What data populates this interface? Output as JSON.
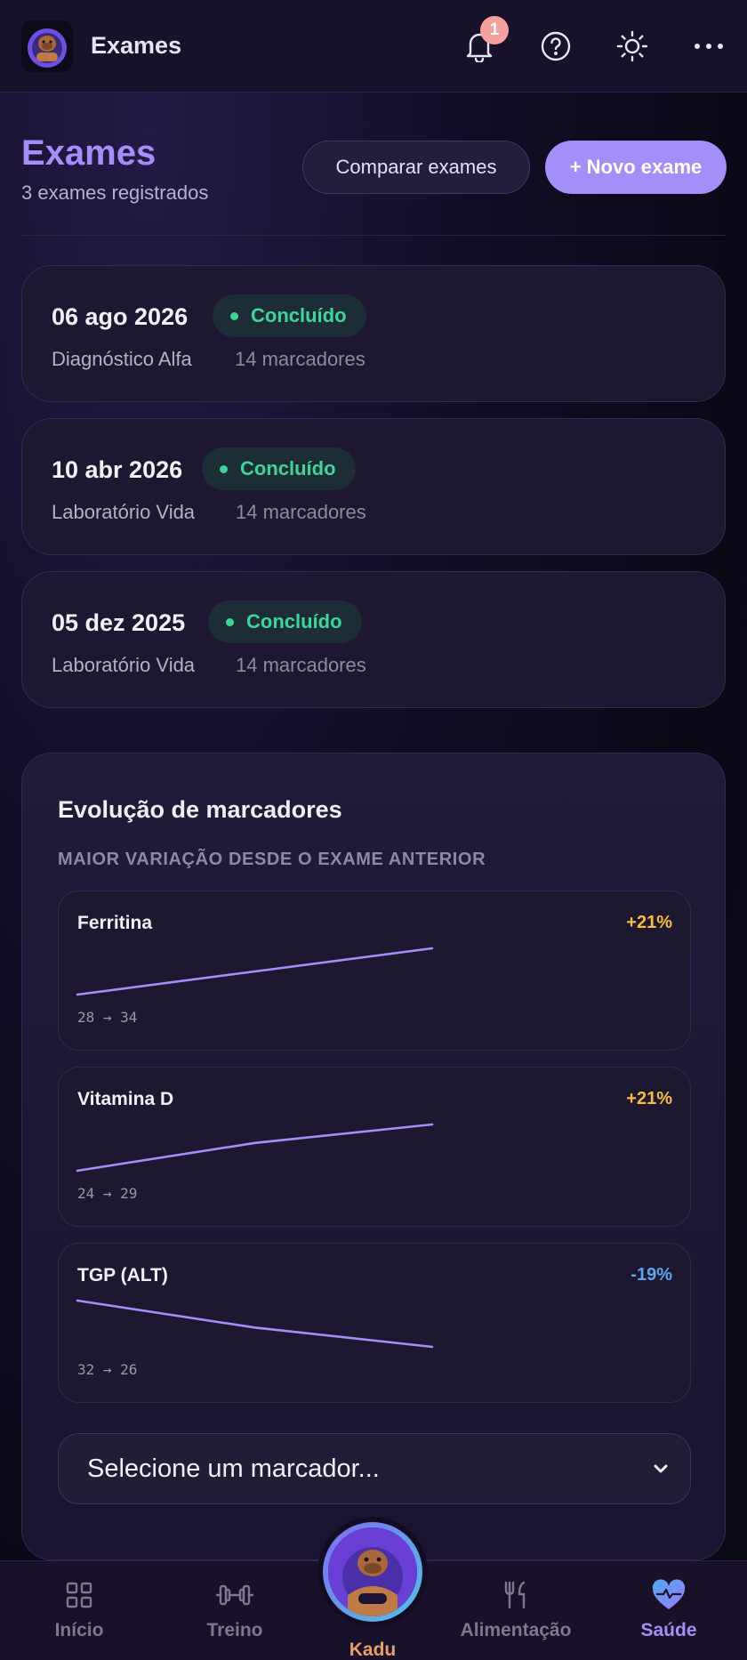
{
  "header": {
    "title": "Exames",
    "notification_count": "1"
  },
  "page": {
    "title": "Exames",
    "subtitle": "3 exames registrados",
    "compare_label": "Comparar exames",
    "new_label": "+ Novo exame"
  },
  "exams": [
    {
      "date": "06 ago 2026",
      "status": "Concluído",
      "lab": "Diagnóstico Alfa",
      "markers": "14 marcadores"
    },
    {
      "date": "10 abr 2026",
      "status": "Concluído",
      "lab": "Laboratório Vida",
      "markers": "14 marcadores"
    },
    {
      "date": "05 dez 2025",
      "status": "Concluído",
      "lab": "Laboratório Vida",
      "markers": "14 marcadores"
    }
  ],
  "evolution": {
    "title": "Evolução de marcadores",
    "subtitle": "MAIOR VARIAÇÃO DESDE O EXAME ANTERIOR",
    "markers": [
      {
        "name": "Ferritina",
        "change": "+21%",
        "values": "28 → 34",
        "change_color": "#f5bd3c",
        "series": [
          28,
          31,
          34
        ]
      },
      {
        "name": "Vitamina D",
        "change": "+21%",
        "values": "24 → 29",
        "change_color": "#f5bd3c",
        "series": [
          24,
          27,
          29
        ]
      },
      {
        "name": "TGP (ALT)",
        "change": "-19%",
        "values": "32 → 26",
        "change_color": "#5aa6f0",
        "series": [
          32,
          28.5,
          26
        ]
      }
    ],
    "select_placeholder": "Selecione um marcador..."
  },
  "nav": {
    "items": [
      {
        "label": "Início",
        "icon": "grid-icon"
      },
      {
        "label": "Treino",
        "icon": "dumbbell-icon"
      },
      {
        "label": "Kadu",
        "icon": "kadu-avatar-icon"
      },
      {
        "label": "Alimentação",
        "icon": "fork-knife-icon"
      },
      {
        "label": "Saúde",
        "icon": "heart-pulse-icon"
      }
    ],
    "active_color": "#a48ef8",
    "kadu_color": "#e8a06a"
  },
  "colors": {
    "accent": "#a48ef8",
    "success": "#3fd49c",
    "positive_change": "#f5bd3c",
    "negative_change": "#5aa6f0",
    "line": "#a48ef8"
  }
}
